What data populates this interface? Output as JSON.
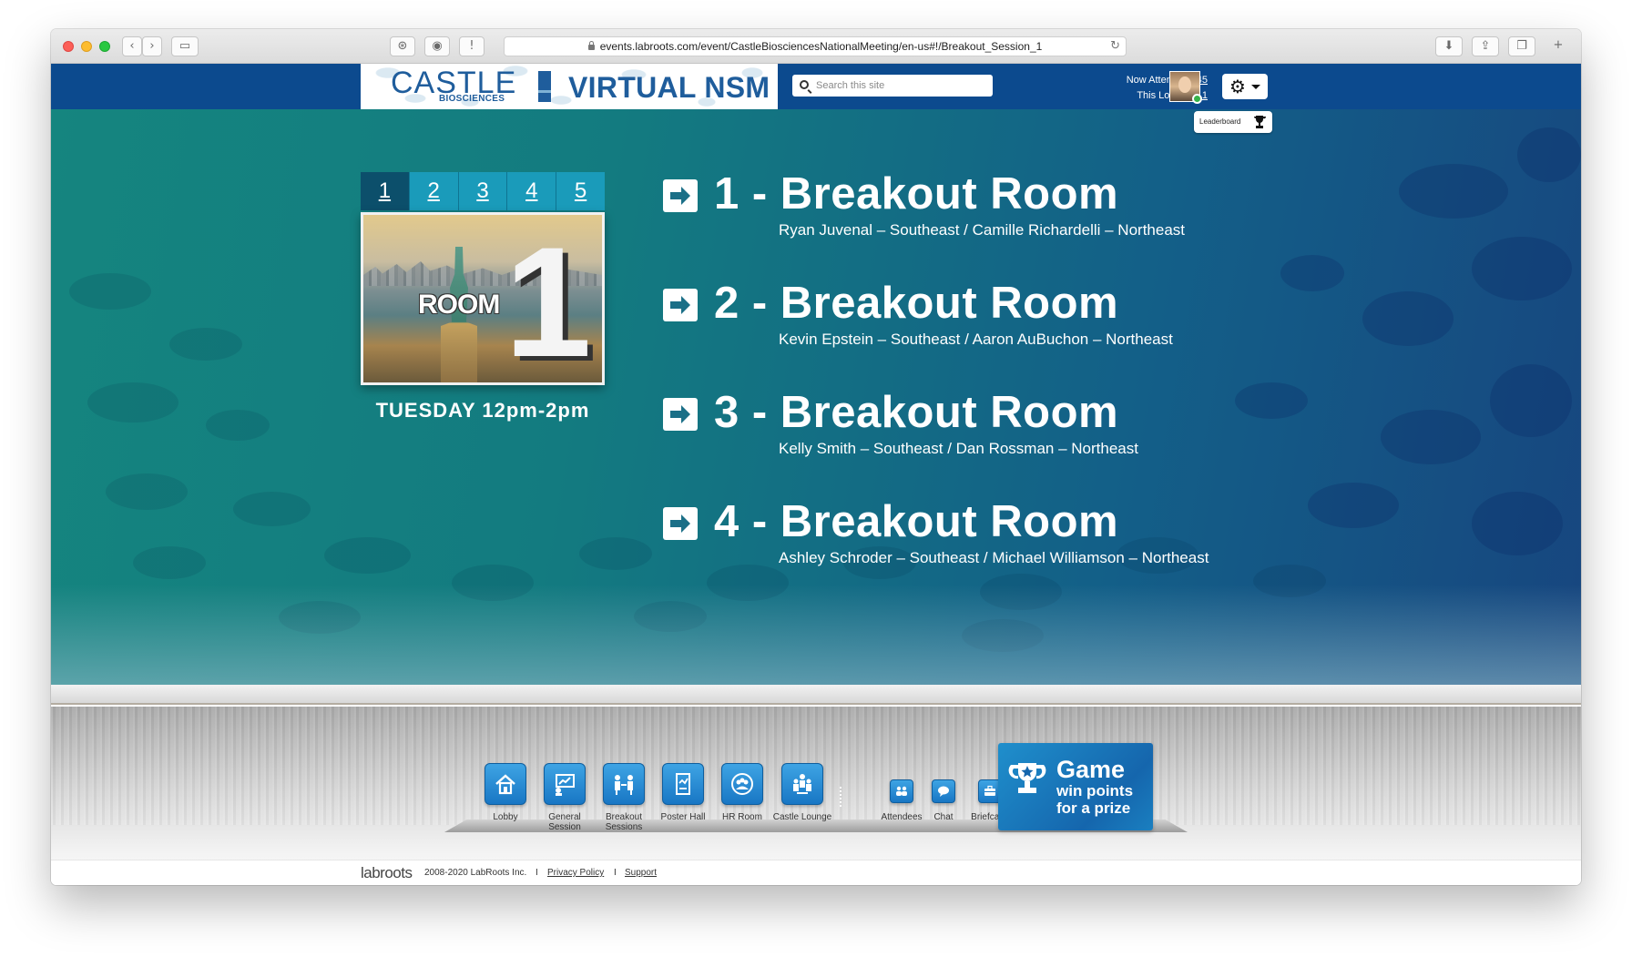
{
  "browser": {
    "url": "events.labroots.com/event/CastleBiosciencesNationalMeeting/en-us#!/Breakout_Session_1"
  },
  "header": {
    "logo_castle": "CASTLE",
    "logo_biosciences": "BIOSCIENCES",
    "logo_event": "VIRTUAL NSM",
    "search_placeholder": "Search this site",
    "now_attending_label": "Now Attending:",
    "now_attending_count": "45",
    "this_location_label": "This Location:",
    "this_location_count": "1",
    "accent_color": "#0c4a8e"
  },
  "leaderboard": {
    "label": "Leaderboard"
  },
  "room_selector": {
    "tabs": [
      "1",
      "2",
      "3",
      "4",
      "5"
    ],
    "active_tab": "1",
    "card_word": "ROOM",
    "card_numeral": "1",
    "schedule": "TUESDAY 12pm-2pm"
  },
  "breakout_rooms": [
    {
      "title": "1 - Breakout Room",
      "hosts": "Ryan Juvenal – Southeast / Camille Richardelli – Northeast"
    },
    {
      "title": "2 - Breakout Room",
      "hosts": "Kevin Epstein – Southeast / Aaron AuBuchon – Northeast"
    },
    {
      "title": "3 - Breakout Room",
      "hosts": "Kelly Smith – Southeast / Dan Rossman – Northeast"
    },
    {
      "title": "4 - Breakout Room",
      "hosts": "Ashley Schroder – Southeast / Michael Williamson – Northeast"
    }
  ],
  "nav": {
    "lobby": "Lobby",
    "general_line1": "General",
    "general_line2": "Session",
    "breakout_line1": "Breakout",
    "breakout_line2": "Sessions",
    "poster": "Poster Hall",
    "hr": "HR Room",
    "castle_lounge": "Castle Lounge",
    "attendees": "Attendees",
    "chat": "Chat",
    "briefcase": "Briefcase"
  },
  "game": {
    "title": "Game",
    "line1": "win points",
    "line2": "for a prize"
  },
  "footer": {
    "logo": "labroots",
    "copyright": "2008-2020 LabRoots Inc.",
    "separator": "I",
    "privacy": "Privacy Policy",
    "support": "Support"
  }
}
